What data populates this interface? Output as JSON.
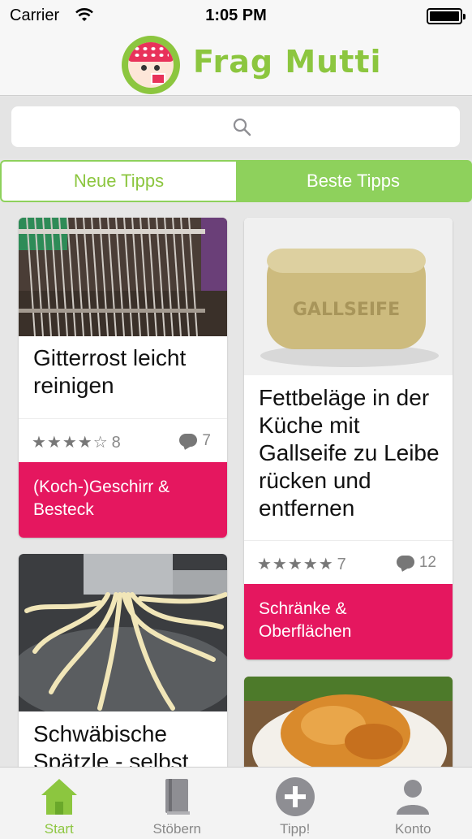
{
  "status_bar": {
    "carrier": "Carrier",
    "time": "1:05 PM"
  },
  "header": {
    "app_title": "Frag Mutti"
  },
  "search": {
    "placeholder": ""
  },
  "segments": [
    {
      "label": "Neue Tipps",
      "active": false
    },
    {
      "label": "Beste Tipps",
      "active": true
    }
  ],
  "colors": {
    "accent_green": "#8ed15c",
    "category_pink": "#e5175f"
  },
  "cards": [
    {
      "title": "Gitterrost leicht reinigen",
      "rating_count": "8",
      "comment_count": "7",
      "category": "(Koch-)Geschirr & Besteck",
      "stars": 4.5,
      "image": "grill-grate-photo"
    },
    {
      "title": "Fettbeläge in der Küche mit Gallseife zu Leibe rücken und entfernen",
      "rating_count": "7",
      "comment_count": "12",
      "category": "Schränke & Oberflächen",
      "stars": 5,
      "image": "gallseife-soap-photo",
      "image_text": "GALLSEIFE"
    },
    {
      "title": "Schwäbische Spätzle - selbst",
      "image": "spaetzle-photo"
    },
    {
      "image": "schnitzel-photo"
    }
  ],
  "tabbar": {
    "items": [
      {
        "label": "Start",
        "icon": "home-icon",
        "active": true
      },
      {
        "label": "Stöbern",
        "icon": "book-icon",
        "active": false
      },
      {
        "label": "Tipp!",
        "icon": "add-icon",
        "active": false
      },
      {
        "label": "Konto",
        "icon": "person-icon",
        "active": false
      }
    ]
  }
}
